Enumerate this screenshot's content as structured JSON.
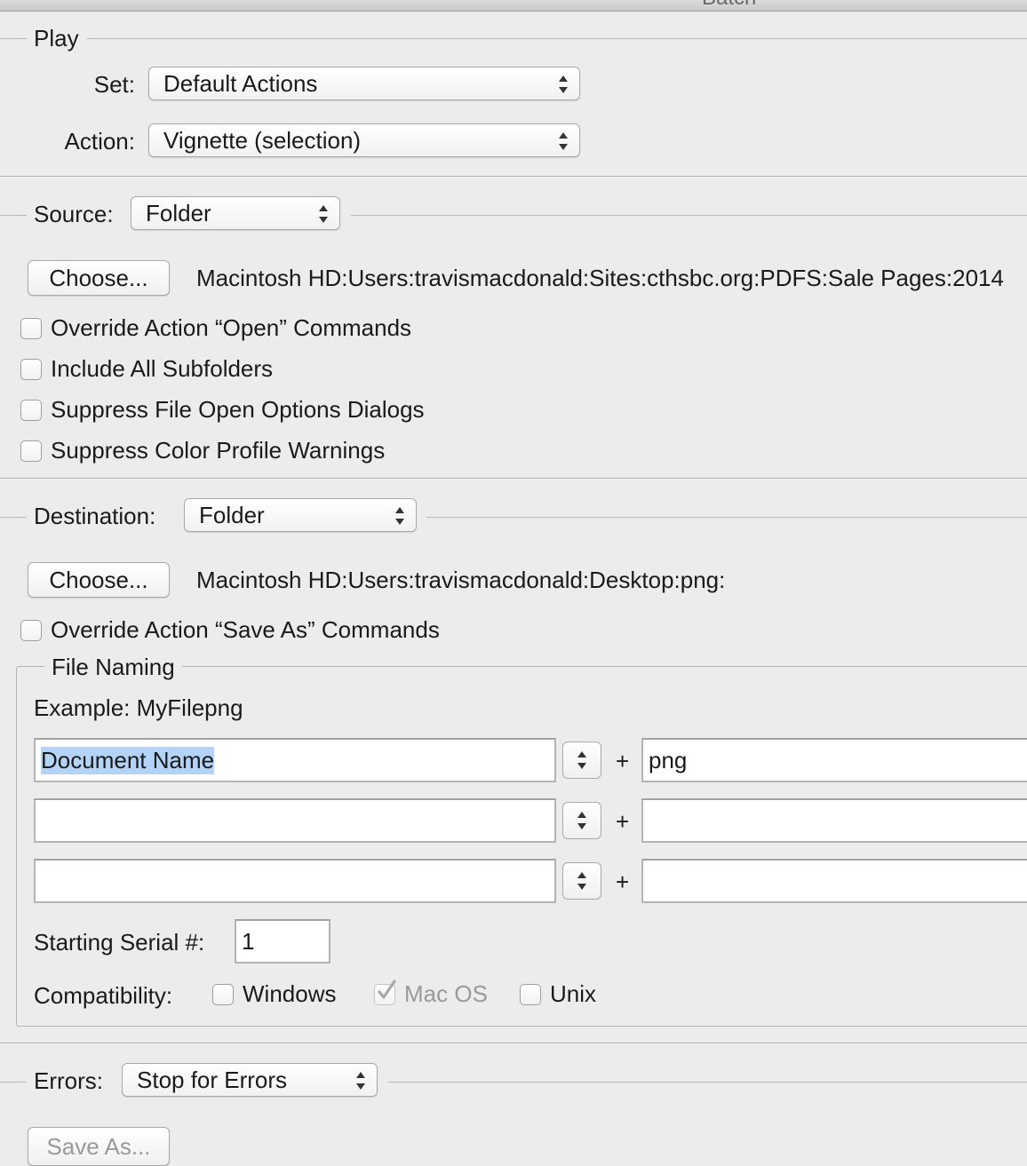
{
  "window": {
    "title": "Batch"
  },
  "play": {
    "heading": "Play",
    "set_label": "Set:",
    "set_value": "Default Actions",
    "action_label": "Action:",
    "action_value": "Vignette (selection)"
  },
  "source": {
    "label": "Source:",
    "value": "Folder",
    "choose_label": "Choose...",
    "path": "Macintosh HD:Users:travismacdonald:Sites:cthsbc.org:PDFS:Sale Pages:2014",
    "options": [
      {
        "label": "Override Action “Open” Commands",
        "checked": false
      },
      {
        "label": "Include All Subfolders",
        "checked": false
      },
      {
        "label": "Suppress File Open Options Dialogs",
        "checked": false
      },
      {
        "label": "Suppress Color Profile Warnings",
        "checked": false
      }
    ]
  },
  "destination": {
    "label": "Destination:",
    "value": "Folder",
    "choose_label": "Choose...",
    "path": "Macintosh HD:Users:travismacdonald:Desktop:png:",
    "override_label": "Override Action “Save As” Commands"
  },
  "file_naming": {
    "heading": "File Naming",
    "example_label": "Example:",
    "example_value": "MyFilepng",
    "plus": "+",
    "rows": [
      {
        "left": "Document Name",
        "right": "png"
      },
      {
        "left": "",
        "right": ""
      },
      {
        "left": "",
        "right": ""
      }
    ],
    "serial_label": "Starting Serial #:",
    "serial_value": "1",
    "compat_label": "Compatibility:",
    "compat": [
      {
        "label": "Windows",
        "checked": false,
        "enabled": true
      },
      {
        "label": "Mac OS",
        "checked": true,
        "enabled": false
      },
      {
        "label": "Unix",
        "checked": false,
        "enabled": true
      }
    ]
  },
  "errors": {
    "label": "Errors:",
    "value": "Stop for Errors",
    "save_as_label": "Save As..."
  },
  "colors": {
    "background": "#ececec",
    "selection": "#b3d4f8",
    "disabled_text": "#9a9a9a"
  }
}
